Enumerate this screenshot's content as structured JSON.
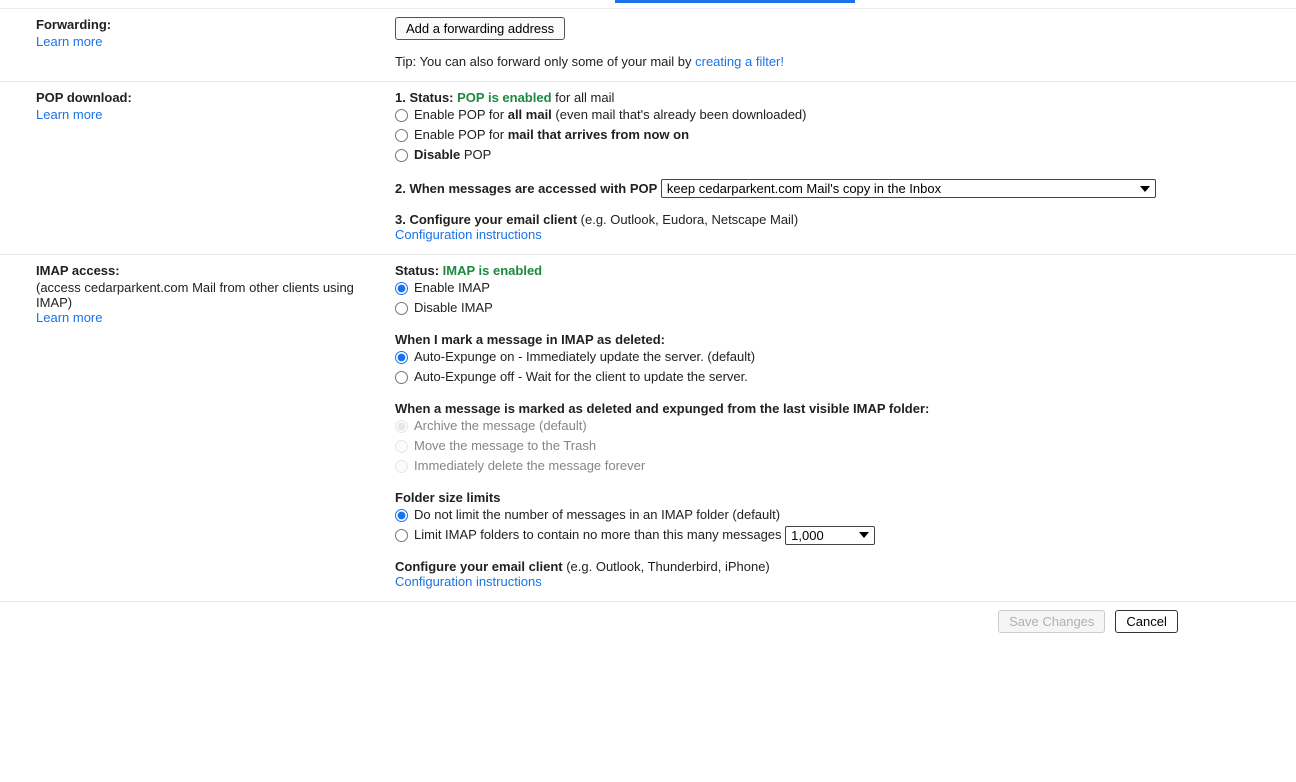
{
  "forwarding": {
    "title": "Forwarding:",
    "learn_more": "Learn more",
    "add_address_btn": "Add a forwarding address",
    "tip_prefix": "Tip: You can also forward only some of your mail by ",
    "tip_link": "creating a filter!"
  },
  "pop": {
    "title": "POP download:",
    "learn_more": "Learn more",
    "status_prefix": "1. Status: ",
    "status_green": "POP is enabled",
    "status_suffix": " for all mail",
    "opt1_prefix": "Enable POP for ",
    "opt1_bold": "all mail",
    "opt1_suffix": " (even mail that's already been downloaded)",
    "opt2_prefix": "Enable POP for ",
    "opt2_bold": "mail that arrives from now on",
    "opt3_bold": "Disable",
    "opt3_suffix": " POP",
    "line2": "2. When messages are accessed with POP",
    "select_value": "keep cedarparkent.com Mail's copy in the Inbox",
    "line3_bold": "3. Configure your email client",
    "line3_suffix": " (e.g. Outlook, Eudora, Netscape Mail)",
    "config_link": "Configuration instructions"
  },
  "imap": {
    "title": "IMAP access:",
    "subtitle": "(access cedarparkent.com Mail from other clients using IMAP)",
    "learn_more": "Learn more",
    "status_prefix": "Status: ",
    "status_green": "IMAP is enabled",
    "enable": "Enable IMAP",
    "disable": "Disable IMAP",
    "deleted_header": "When I mark a message in IMAP as deleted:",
    "expunge_on": "Auto-Expunge on - Immediately update the server. (default)",
    "expunge_off": "Auto-Expunge off - Wait for the client to update the server.",
    "expunged_header": "When a message is marked as deleted and expunged from the last visible IMAP folder:",
    "archive": "Archive the message (default)",
    "trash": "Move the message to the Trash",
    "delete_forever": "Immediately delete the message forever",
    "folder_header": "Folder size limits",
    "folder_opt1": "Do not limit the number of messages in an IMAP folder (default)",
    "folder_opt2": "Limit IMAP folders to contain no more than this many messages",
    "folder_select": "1,000",
    "configure_bold": "Configure your email client",
    "configure_suffix": " (e.g. Outlook, Thunderbird, iPhone)",
    "config_link": "Configuration instructions"
  },
  "footer": {
    "save": "Save Changes",
    "cancel": "Cancel"
  }
}
